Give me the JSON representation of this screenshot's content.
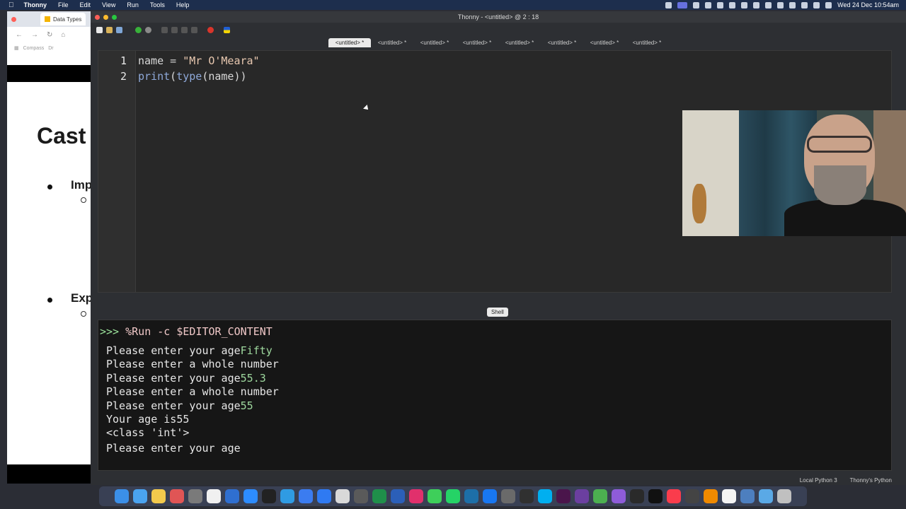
{
  "menubar": {
    "app_name": "Thonny",
    "menus": [
      "File",
      "Edit",
      "View",
      "Run",
      "Tools",
      "Help"
    ],
    "clock": "Wed 24 Dec  10:54am"
  },
  "browser": {
    "tab_title": "Data Types",
    "bookmark_compass": "Compass",
    "bookmark_drive": "Dr",
    "slide_title": "Cast",
    "bullet_1": "Imp",
    "bullet_2": "Exp"
  },
  "thonny": {
    "window_title": "Thonny  -  <untitled>  @  2 : 18",
    "tabs": [
      "<untitled> *",
      "<untitled> *",
      "<untitled> *",
      "<untitled> *",
      "<untitled> *",
      "<untitled> *",
      "<untitled> *",
      "<untitled> *"
    ],
    "editor": {
      "line_numbers": [
        "1",
        "2"
      ],
      "line1": {
        "var": "name",
        "op": " = ",
        "str": "\"Mr O'Meara\""
      },
      "line2": {
        "fn1": "print",
        "p1": "(",
        "fn2": "type",
        "rest": "(name))"
      }
    },
    "shell_tab": "Shell",
    "shell": {
      "prompt": ">>> ",
      "command": "%Run -c $EDITOR_CONTENT",
      "lines": [
        {
          "text": "Please enter your age",
          "input": "Fifty"
        },
        {
          "text": "Please enter a whole number",
          "input": ""
        },
        {
          "text": "Please enter your age",
          "input": "55.3"
        },
        {
          "text": "Please enter a whole number",
          "input": ""
        },
        {
          "text": "Please enter your age",
          "input": "55"
        },
        {
          "text": "Your age is55",
          "input": ""
        },
        {
          "text": "<class 'int'>",
          "input": ""
        },
        {
          "text": "Please enter your age",
          "input": ""
        }
      ]
    },
    "status": {
      "interpreter": "Local Python 3",
      "python_name": "Thonny's Python"
    }
  },
  "colors": {
    "editor_bg": "#282828",
    "shell_bg": "#161616",
    "prompt_green": "#9be39b",
    "input_green": "#9ed89e",
    "menubar_bg": "#1d2e4d"
  },
  "dock_icons": [
    "finder-icon",
    "mail-icon",
    "notes-icon",
    "launchpad-icon",
    "settings-icon",
    "chrome-icon",
    "outlook-icon",
    "zoom-icon",
    "terminal-icon",
    "vscode-icon",
    "messenger-icon",
    "appstore-icon",
    "preview-icon",
    "cog-icon",
    "excel-icon",
    "word-icon",
    "instagram-icon",
    "messages-icon",
    "whatsapp-icon",
    "virtualbox-icon",
    "facebook-icon",
    "settings2-icon",
    "activity-icon",
    "skype-icon",
    "slack-icon",
    "imovie-icon",
    "maps-icon",
    "download-icon",
    "code-icon",
    "terminal2-icon",
    "music-icon",
    "calc-icon",
    "vlc-icon",
    "calendar-icon",
    "thonny-icon",
    "folder-icon",
    "trash-icon"
  ]
}
